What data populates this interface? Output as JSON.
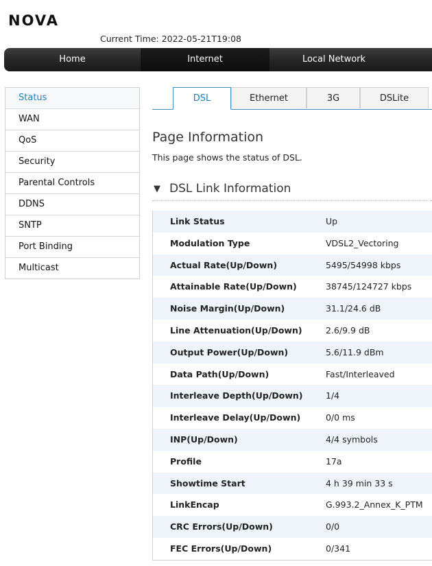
{
  "header": {
    "logo": "NOVA",
    "current_time": "Current Time: 2022-05-21T19:08"
  },
  "nav": {
    "items": [
      "Home",
      "Internet",
      "Local Network"
    ],
    "active": "Internet"
  },
  "sidebar": {
    "items": [
      "Status",
      "WAN",
      "QoS",
      "Security",
      "Parental Controls",
      "DDNS",
      "SNTP",
      "Port Binding",
      "Multicast"
    ],
    "active": "Status"
  },
  "tabs": {
    "items": [
      "DSL",
      "Ethernet",
      "3G",
      "DSLite"
    ],
    "active": "DSL"
  },
  "page_info": {
    "title": "Page Information",
    "description": "This page shows the status of DSL."
  },
  "section": {
    "arrow": "▼",
    "title": "DSL Link Information"
  },
  "dsl_table": {
    "rows": [
      {
        "label": "Link Status",
        "value": "Up"
      },
      {
        "label": "Modulation Type",
        "value": "VDSL2_Vectoring"
      },
      {
        "label": "Actual Rate(Up/Down)",
        "value": "5495/54998 kbps"
      },
      {
        "label": "Attainable Rate(Up/Down)",
        "value": "38745/124727 kbps"
      },
      {
        "label": "Noise Margin(Up/Down)",
        "value": "31.1/24.6 dB"
      },
      {
        "label": "Line Attenuation(Up/Down)",
        "value": "2.6/9.9 dB"
      },
      {
        "label": "Output Power(Up/Down)",
        "value": "5.6/11.9 dBm"
      },
      {
        "label": "Data Path(Up/Down)",
        "value": "Fast/Interleaved"
      },
      {
        "label": "Interleave Depth(Up/Down)",
        "value": "1/4"
      },
      {
        "label": "Interleave Delay(Up/Down)",
        "value": "0/0 ms"
      },
      {
        "label": "INP(Up/Down)",
        "value": "4/4 symbols"
      },
      {
        "label": "Profile",
        "value": "17a"
      },
      {
        "label": "Showtime Start",
        "value": "4 h 39 min 33 s"
      },
      {
        "label": "LinkEncap",
        "value": "G.993.2_Annex_K_PTM"
      },
      {
        "label": "CRC Errors(Up/Down)",
        "value": "0/0"
      },
      {
        "label": "FEC Errors(Up/Down)",
        "value": "0/341"
      }
    ]
  },
  "colors": {
    "accent": "#1f7fb8",
    "nav_bg": "#262626",
    "row_alt": "#eef4fa"
  }
}
